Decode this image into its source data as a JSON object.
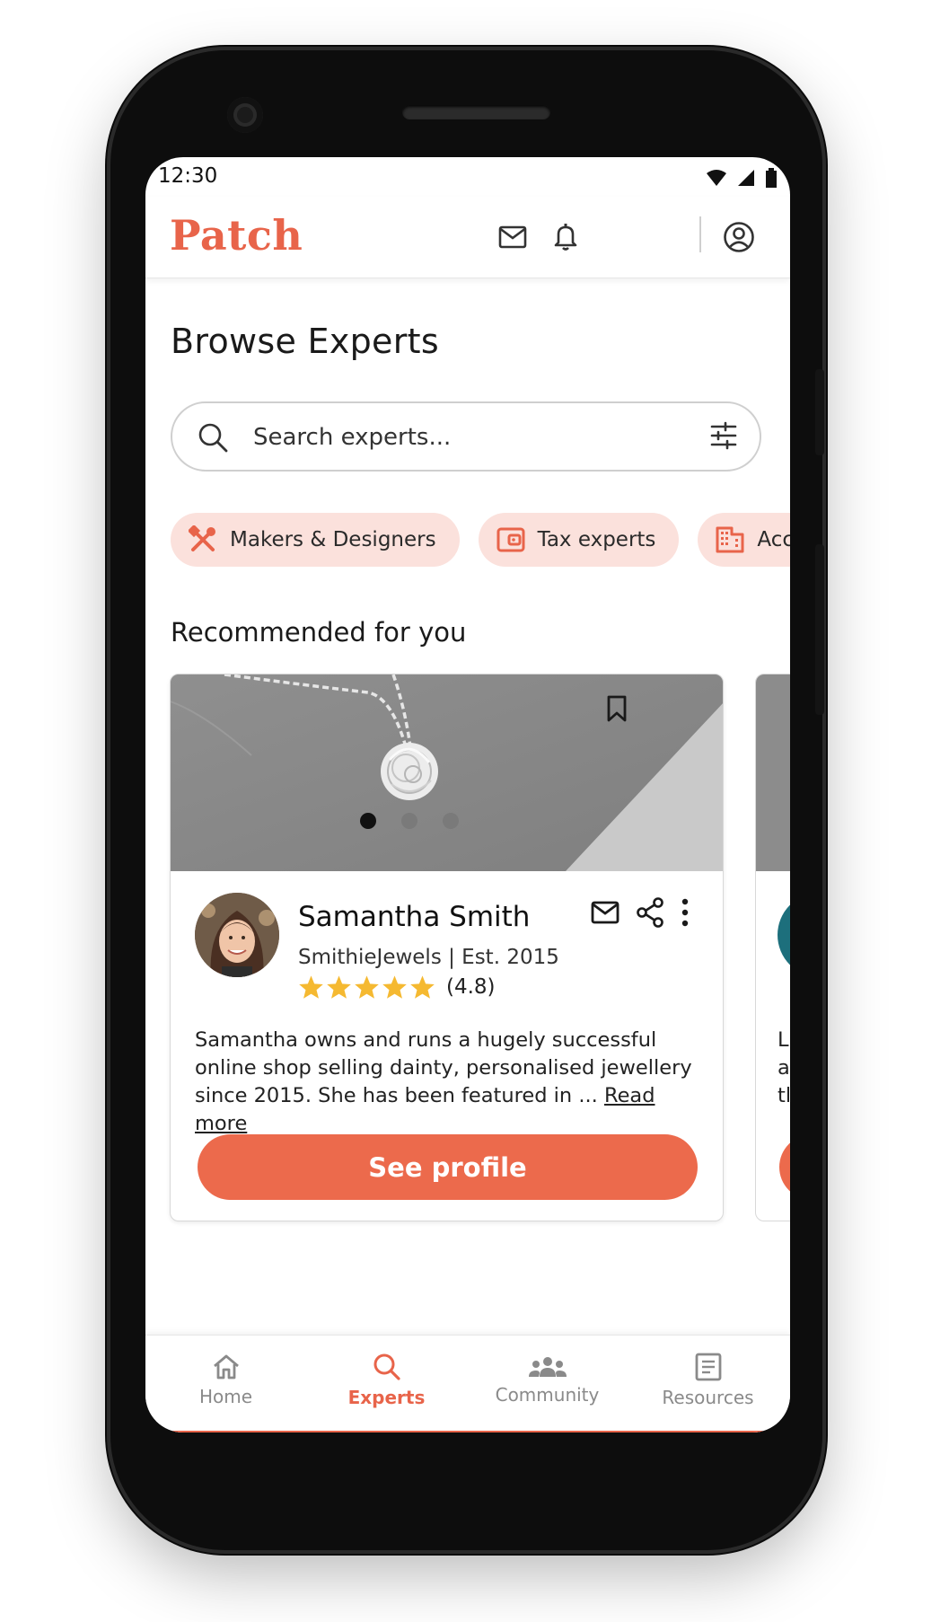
{
  "status_bar": {
    "time": "12:30",
    "icons": [
      "wifi-icon",
      "signal-icon",
      "battery-icon"
    ]
  },
  "app_bar": {
    "logo": "Patch",
    "icons": [
      "mail-icon",
      "bell-icon",
      "account-icon"
    ]
  },
  "page": {
    "title": "Browse Experts"
  },
  "search": {
    "placeholder": "Search experts...",
    "value": "",
    "icon": "search-icon",
    "filter_icon": "filter-icon"
  },
  "categories": [
    {
      "label": "Makers & Designers",
      "icon": "tools-icon"
    },
    {
      "label": "Tax experts",
      "icon": "wallet-icon"
    },
    {
      "label": "Acc",
      "icon": "building-icon"
    }
  ],
  "recommended": {
    "title": "Recommended for you",
    "card": {
      "name": "Samantha Smith",
      "shop": "SmithieJewels | Est. 2015",
      "rating": 4.8,
      "rating_text": "(4.8)",
      "bio": "Samantha owns and runs a hugely successful online shop selling dainty, personalised jewellery since 2015. She has been featured in ...",
      "read_more": "Read more",
      "cta": "See profile",
      "carousel": {
        "pages": 3,
        "active": 1
      },
      "icons": [
        "bookmark-icon",
        "mail-icon",
        "share-icon",
        "more-icon"
      ]
    },
    "next_card_text": [
      "L",
      "a",
      "tl"
    ]
  },
  "bottom_nav": [
    {
      "label": "Home",
      "icon": "home-icon",
      "active": false
    },
    {
      "label": "Experts",
      "icon": "search-icon",
      "active": true
    },
    {
      "label": "Community",
      "icon": "community-icon",
      "active": false
    },
    {
      "label": "Resources",
      "icon": "resources-icon",
      "active": false
    }
  ],
  "colors": {
    "accent": "#e8644a",
    "chip_bg": "#fbe1dc",
    "cta": "#ec6a4c",
    "star": "#f5b931"
  }
}
